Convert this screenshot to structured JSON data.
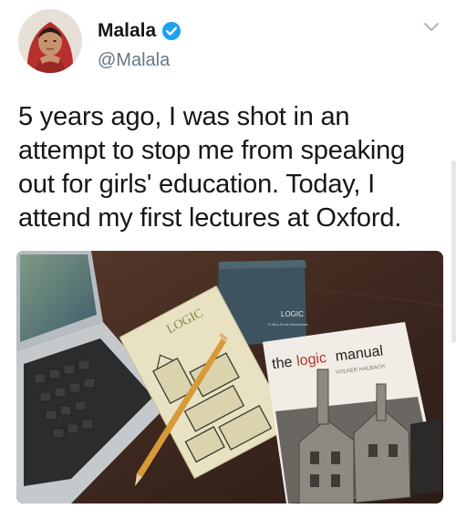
{
  "author": {
    "name": "Malala",
    "handle": "@Malala",
    "verified": true
  },
  "tweet": {
    "lines": [
      "5 years ago, I was shot in an",
      "attempt to stop me from speaking",
      "out for girls' education. Today, I",
      "attend my first lectures at Oxford."
    ]
  },
  "photo": {
    "book_logic_short": "LOGIC",
    "book_logic_short_sub": "A Very Short Introduction",
    "book_logic_illustrated": "LOGIC",
    "book_manual_the": "the",
    "book_manual_logic": "logic",
    "book_manual_manual": "manual",
    "book_manual_author": "VOLKER HALBACH"
  },
  "colors": {
    "verified": "#1da1f2",
    "handle": "#657786",
    "text": "#14171a"
  }
}
